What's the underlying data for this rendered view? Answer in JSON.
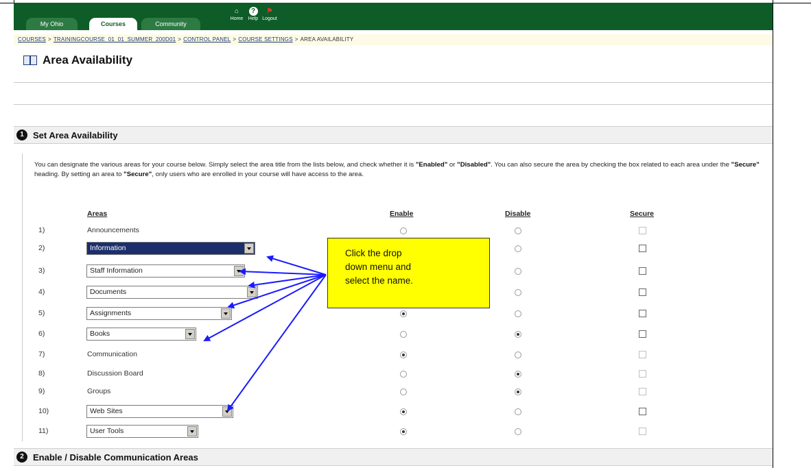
{
  "nav": {
    "tabs": [
      {
        "label": "My Ohio"
      },
      {
        "label": "Courses"
      },
      {
        "label": "Community"
      }
    ],
    "icons": [
      {
        "name": "home-icon",
        "label": "Home"
      },
      {
        "name": "help-icon",
        "label": "Help"
      },
      {
        "name": "logout-icon",
        "label": "Logout"
      }
    ]
  },
  "breadcrumb": {
    "items": [
      "COURSES",
      "TRAININGCOURSE_01_01_SUMMER_200D01",
      "CONTROL PANEL",
      "COURSE SETTINGS",
      "AREA AVAILABILITY"
    ],
    "separator": ">"
  },
  "page": {
    "title": "Area Availability",
    "icon": "book-icon"
  },
  "section1": {
    "number": "1",
    "title": "Set Area Availability",
    "description": {
      "part1": "You can designate the various areas for your course below. Simply select the area title from the lists below, and check whether it is ",
      "enabled": "\"Enabled\"",
      "or": " or ",
      "disabled": "\"Disabled\"",
      "part2": ". You can also secure the area by checking the box related to each area under the ",
      "secure1": "\"Secure\"",
      "part3": " heading. By setting an area to ",
      "secure2": "\"Secure\"",
      "part4": ", only users who are enrolled in your course will have access to the area."
    },
    "columns": {
      "areas": "Areas",
      "enable": "Enable",
      "disable": "Disable",
      "secure": "Secure"
    },
    "rows": [
      {
        "num": "1)",
        "area": "Announcements",
        "type": "text",
        "enabled": false,
        "disabled": false,
        "secure_enabled": false
      },
      {
        "num": "2)",
        "area": "Information",
        "type": "select",
        "selected": true,
        "enabled": false,
        "disabled": false,
        "secure_enabled": true
      },
      {
        "num": "3)",
        "area": "Staff Information",
        "type": "select",
        "enabled": false,
        "disabled": false,
        "secure_enabled": true
      },
      {
        "num": "4)",
        "area": "Documents",
        "type": "select",
        "enabled": false,
        "disabled": false,
        "secure_enabled": true
      },
      {
        "num": "5)",
        "area": "Assignments",
        "type": "select",
        "enabled": true,
        "disabled": false,
        "secure_enabled": true
      },
      {
        "num": "6)",
        "area": "Books",
        "type": "select",
        "enabled": false,
        "disabled": true,
        "secure_enabled": true
      },
      {
        "num": "7)",
        "area": "Communication",
        "type": "text",
        "enabled": true,
        "disabled": false,
        "secure_enabled": false
      },
      {
        "num": "8)",
        "area": "Discussion Board",
        "type": "text",
        "enabled": false,
        "disabled": true,
        "secure_enabled": false
      },
      {
        "num": "9)",
        "area": "Groups",
        "type": "text",
        "enabled": false,
        "disabled": true,
        "secure_enabled": false
      },
      {
        "num": "10)",
        "area": "Web Sites",
        "type": "select",
        "enabled": true,
        "disabled": false,
        "secure_enabled": true
      },
      {
        "num": "11)",
        "area": "User Tools",
        "type": "select",
        "enabled": true,
        "disabled": false,
        "secure_enabled": false
      }
    ]
  },
  "callout": {
    "lines": [
      "Click the drop",
      "down menu and",
      "select the name."
    ],
    "color": "#ffff00",
    "arrow_color": "#1a1aff"
  },
  "section2": {
    "number": "2",
    "title": "Enable / Disable Communication Areas"
  },
  "colors": {
    "nav_green": "#0e5c27",
    "breadcrumb_bg": "#fdfbe6",
    "selected_dropdown": "#1c2e6b"
  }
}
